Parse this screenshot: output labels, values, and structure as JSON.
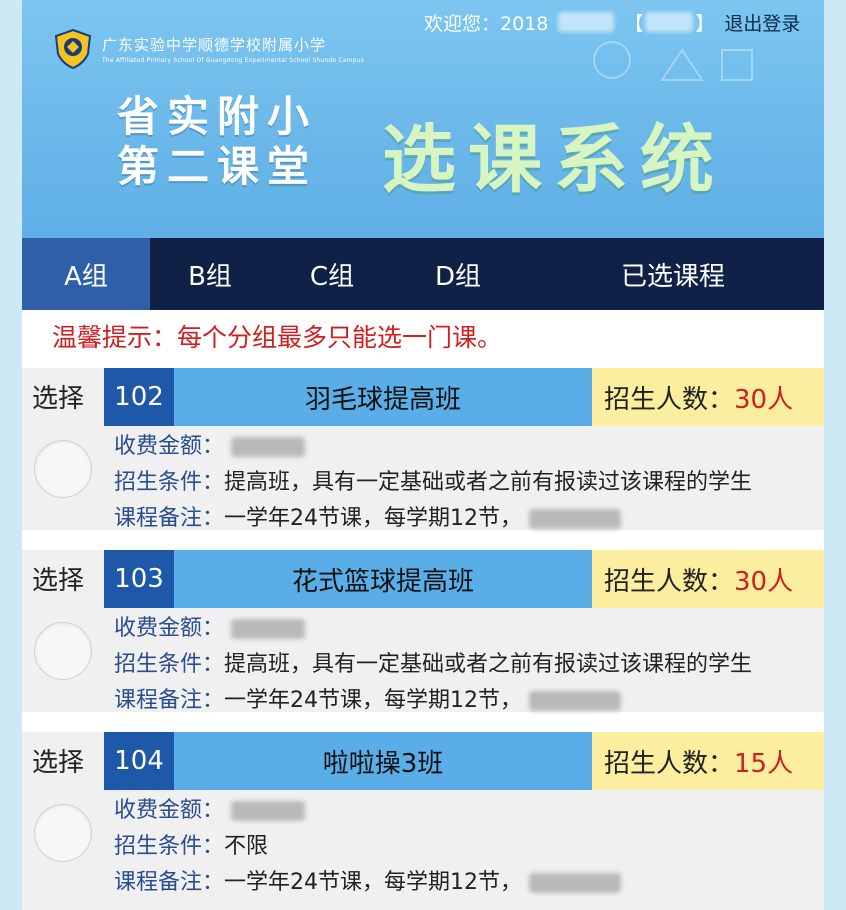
{
  "header": {
    "welcome_label": "欢迎您：",
    "user_id_prefix": "2018",
    "bracket_open": "【",
    "bracket_close": "】",
    "logout_label": "退出登录",
    "school_name_cn": "广东实验中学顺德学校附属小学",
    "school_name_en": "The Affiliated Primary School Of Guangdong Experimental School Shunde Campus",
    "title_left_line1": "省实附小",
    "title_left_line2": "第二课堂",
    "title_right": "选课系统"
  },
  "nav": {
    "tabs": [
      {
        "label": "A组",
        "active": true
      },
      {
        "label": "B组",
        "active": false
      },
      {
        "label": "C组",
        "active": false
      },
      {
        "label": "D组",
        "active": false
      },
      {
        "label": "已选课程",
        "active": false
      }
    ]
  },
  "notice": "温馨提示：每个分组最多只能选一门课。",
  "labels": {
    "select": "选择",
    "quota": "招生人数：",
    "fee": "收费金额：",
    "requirement": "招生条件：",
    "note": "课程备注："
  },
  "courses": [
    {
      "id": "102",
      "name": "羽毛球提高班",
      "quota": "30人",
      "requirement": "提高班，具有一定基础或者之前有报读过该课程的学生",
      "note": "一学年24节课，每学期12节，"
    },
    {
      "id": "103",
      "name": "花式篮球提高班",
      "quota": "30人",
      "requirement": "提高班，具有一定基础或者之前有报读过该课程的学生",
      "note": "一学年24节课，每学期12节，"
    },
    {
      "id": "104",
      "name": "啦啦操3班",
      "quota": "15人",
      "requirement": "不限",
      "note": "一学年24节课，每学期12节，"
    }
  ],
  "colors": {
    "nav_bg": "#0f2147",
    "tab_active": "#2f5fa9",
    "course_id_bg": "#1e58a8",
    "course_name_bg": "#5aaee8",
    "quota_bg": "#fbee9f",
    "notice_red": "#d01f1f"
  }
}
